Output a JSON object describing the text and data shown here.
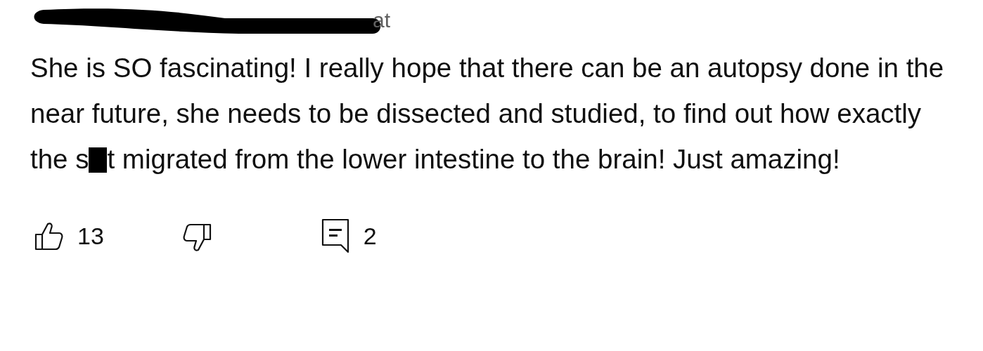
{
  "author": {
    "visible_text": "at",
    "redacted": true
  },
  "comment": {
    "text_before_redaction": "She is SO fascinating! I really hope that there can be an autopsy done in the near future, she needs to be dissected and studied, to find out how exactly the s",
    "redacted": true,
    "text_after_redaction": "t migrated from the lower intestine to the brain! Just amazing!"
  },
  "actions": {
    "likes": "13",
    "replies": "2"
  }
}
